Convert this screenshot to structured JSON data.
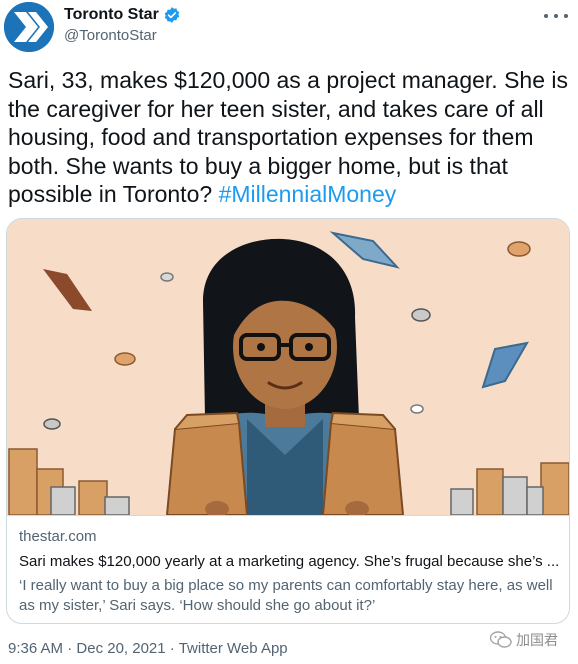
{
  "author": {
    "name": "Toronto Star",
    "handle": "@TorontoStar",
    "verified": true,
    "avatar_icon": "toronto-star-logo-icon",
    "brand_color": "#1c73b8"
  },
  "tweet": {
    "text_main": "Sari, 33, makes $120,000 as a project manager. She is the caregiver for her teen sister, and takes care of all housing, food and transportation expenses for them both. She wants to buy a bigger home, but is that possible in Toronto? ",
    "hashtag": "#MillennialMoney",
    "hashtag_color": "#1d9bf0"
  },
  "card": {
    "image_icon": "illustration-woman-with-paper-bags",
    "domain": "thestar.com",
    "title": "Sari makes $120,000 yearly at a marketing agency. She’s frugal because she’s ...",
    "description": "‘I really want to buy a big place so my parents can comfortably stay here, as well as my sister,’ Sari says. ‘How should she go about it?’"
  },
  "footer": {
    "time": "9:36 AM",
    "separator": " · ",
    "date": "Dec 20, 2021",
    "source": "Twitter Web App"
  },
  "watermark": {
    "text": "加国君"
  }
}
